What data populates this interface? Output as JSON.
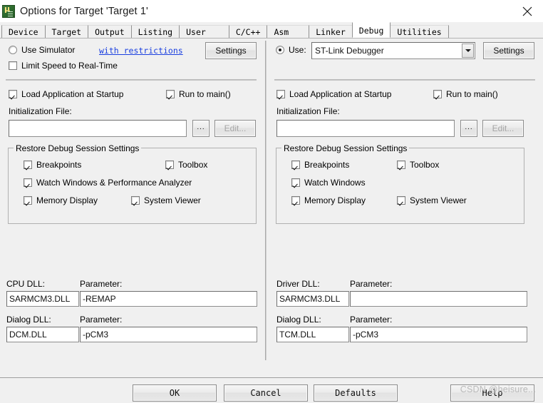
{
  "window": {
    "title": "Options for Target 'Target 1'",
    "icon": "uvision-icon",
    "close_label": "✕"
  },
  "tabs": [
    {
      "label": "Device",
      "active": false
    },
    {
      "label": "Target",
      "active": false
    },
    {
      "label": "Output",
      "active": false
    },
    {
      "label": "Listing",
      "active": false
    },
    {
      "label": "User",
      "active": false
    },
    {
      "label": "C/C++",
      "active": false
    },
    {
      "label": "Asm",
      "active": false
    },
    {
      "label": "Linker",
      "active": false
    },
    {
      "label": "Debug",
      "active": true
    },
    {
      "label": "Utilities",
      "active": false
    }
  ],
  "left_panel": {
    "use_simulator": {
      "label": "Use Simulator",
      "checked": false
    },
    "with_restrictions_link": "with restrictions",
    "settings_button": "Settings",
    "limit_speed": {
      "label": "Limit Speed to Real-Time",
      "checked": false
    },
    "load_app": {
      "label": "Load Application at Startup",
      "checked": true
    },
    "run_to_main": {
      "label": "Run to main()",
      "checked": true
    },
    "init_file_label": "Initialization File:",
    "init_file_value": "",
    "browse_button": "...",
    "edit_button": "Edit...",
    "restore_group": {
      "title": "Restore Debug Session Settings",
      "items": [
        {
          "label": "Breakpoints",
          "checked": true
        },
        {
          "label": "Toolbox",
          "checked": true
        },
        {
          "label": "Watch Windows & Performance Analyzer",
          "checked": true
        },
        {
          "label": "Memory Display",
          "checked": true
        },
        {
          "label": "System Viewer",
          "checked": true
        }
      ]
    },
    "cpu_dll_label": "CPU DLL:",
    "cpu_dll_value": "SARMCM3.DLL",
    "cpu_param_label": "Parameter:",
    "cpu_param_value": "-REMAP",
    "dialog_dll_label": "Dialog DLL:",
    "dialog_dll_value": "DCM.DLL",
    "dialog_param_label": "Parameter:",
    "dialog_param_value": "-pCM3"
  },
  "right_panel": {
    "use_radio": {
      "label": "Use:",
      "checked": true
    },
    "debugger_selected": "ST-Link Debugger",
    "settings_button": "Settings",
    "load_app": {
      "label": "Load Application at Startup",
      "checked": true
    },
    "run_to_main": {
      "label": "Run to main()",
      "checked": true
    },
    "init_file_label": "Initialization File:",
    "init_file_value": "",
    "browse_button": "...",
    "edit_button": "Edit...",
    "restore_group": {
      "title": "Restore Debug Session Settings",
      "items": [
        {
          "label": "Breakpoints",
          "checked": true
        },
        {
          "label": "Toolbox",
          "checked": true
        },
        {
          "label": "Watch Windows",
          "checked": true
        },
        {
          "label": "Memory Display",
          "checked": true
        },
        {
          "label": "System Viewer",
          "checked": true
        }
      ]
    },
    "driver_dll_label": "Driver DLL:",
    "driver_dll_value": "SARMCM3.DLL",
    "driver_param_label": "Parameter:",
    "driver_param_value": "",
    "dialog_dll_label": "Dialog DLL:",
    "dialog_dll_value": "TCM.DLL",
    "dialog_param_label": "Parameter:",
    "dialog_param_value": "-pCM3"
  },
  "footer": {
    "ok": "OK",
    "cancel": "Cancel",
    "defaults": "Defaults",
    "help": "Help"
  },
  "watermark": "CSDN @heisure...",
  "colors": {
    "dialog_bg": "#f0f0f0",
    "titlebar_bg": "#ffffff",
    "link": "#1a3fe0",
    "field_bg": "#ffffff",
    "border": "#8e8e8e"
  }
}
